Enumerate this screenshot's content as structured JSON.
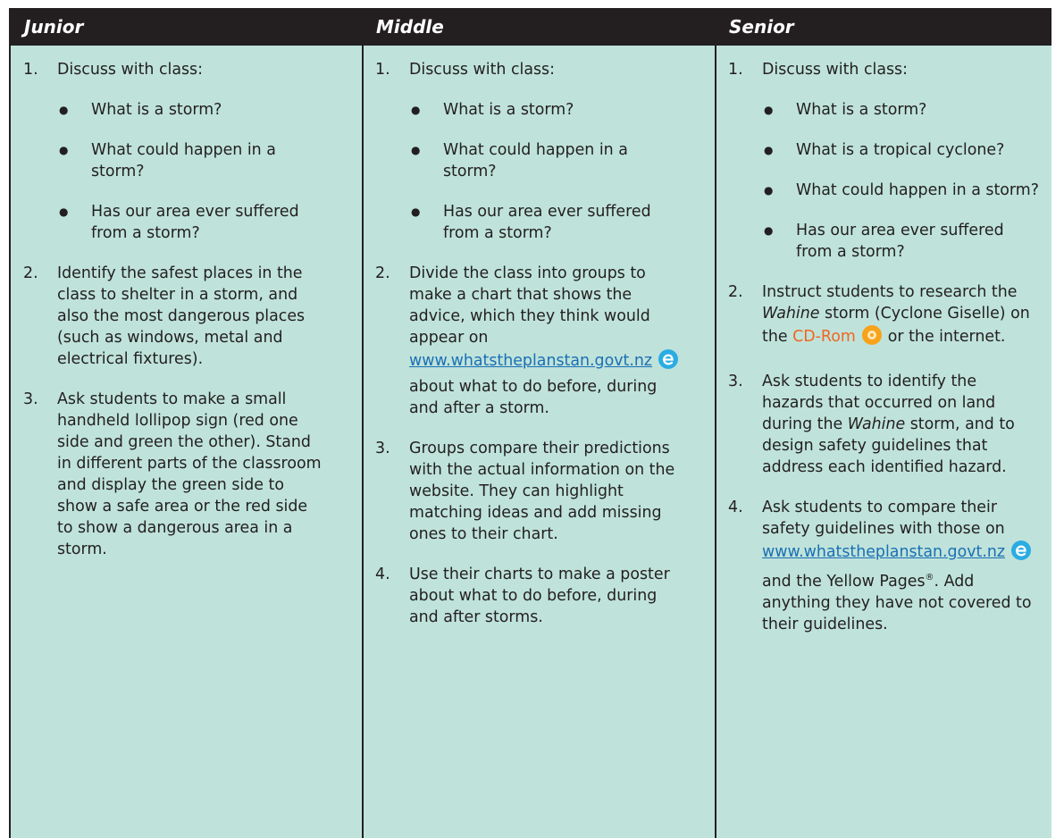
{
  "columns": {
    "junior": "Junior",
    "middle": "Middle",
    "senior": "Senior"
  },
  "junior": {
    "item1": {
      "num": "1.",
      "text": "Discuss with class:"
    },
    "bullets": [
      "What is a storm?",
      "What could happen in a storm?",
      "Has our area ever suffered from a storm?"
    ],
    "item2": {
      "num": "2.",
      "text": "Identify the safest places in the class to shelter in a storm, and also the most dangerous places (such as windows, metal and electrical fixtures)."
    },
    "item3": {
      "num": "3.",
      "text": "Ask students to make a small handheld lollipop sign (red one side and green the other). Stand in different parts of the classroom and display the green side to show a safe area or the red side to show a dangerous area in a storm."
    }
  },
  "middle": {
    "item1": {
      "num": "1.",
      "text": "Discuss with class:"
    },
    "bullets": [
      "What is a storm?",
      "What could happen in a storm?",
      "Has our area ever suffered from a storm?"
    ],
    "item2": {
      "num": "2.",
      "text_before": "Divide the class into groups to make a chart that shows the advice, which they think would appear on",
      "link": "www.whatstheplanstan.govt.nz",
      "text_after": "about what to do before, during and after a storm."
    },
    "item3": {
      "num": "3.",
      "text": "Groups compare their predictions with the actual information on the website. They can highlight matching ideas and add missing ones to their chart."
    },
    "item4": {
      "num": "4.",
      "text": "Use their charts to make a poster about what to do before, during and after storms."
    }
  },
  "senior": {
    "item1": {
      "num": "1.",
      "text": "Discuss with class:"
    },
    "bullets": [
      "What is a storm?",
      "What is a tropical cyclone?",
      "What could happen in a storm?",
      "Has our area ever suffered from a storm?"
    ],
    "item2": {
      "num": "2.",
      "text_a": "Instruct students to research the",
      "italic": "Wahine",
      "text_b": "storm (Cyclone Giselle) on the",
      "cd": "CD-Rom",
      "text_c": "or the internet."
    },
    "item3": {
      "num": "3.",
      "text_a": "Ask students to identify the hazards that occurred on land during the",
      "italic": "Wahine",
      "text_b": "storm, and to design safety guidelines that address each identified hazard."
    },
    "item4": {
      "num": "4.",
      "text_a": "Ask students to compare their safety guidelines with those on",
      "link": "www.whatstheplanstan.govt.nz",
      "text_b": "and the Yellow Pages",
      "reg": "®",
      "text_c": ". Add anything they have not covered to their guidelines."
    }
  }
}
